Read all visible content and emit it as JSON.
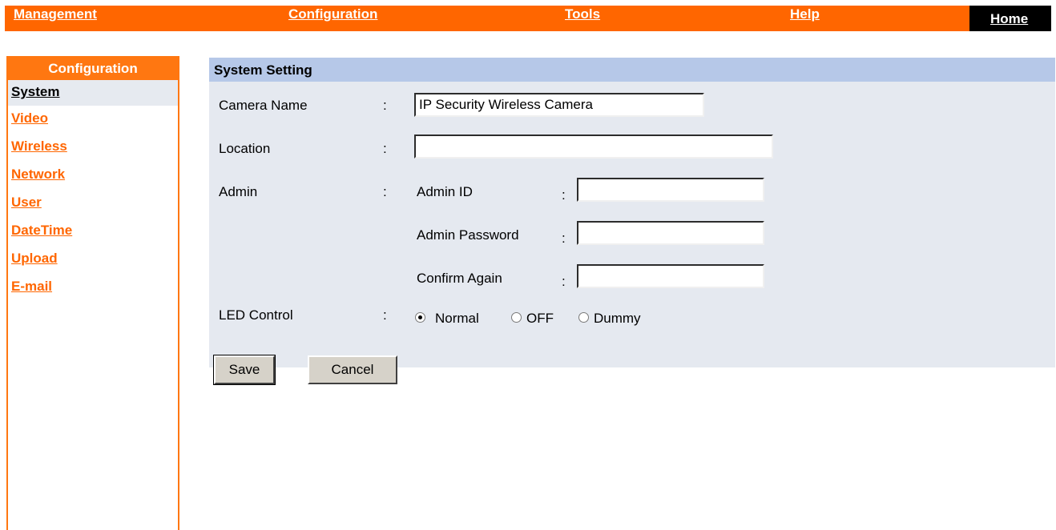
{
  "topnav": {
    "management": "Management",
    "configuration": "Configuration",
    "tools": "Tools",
    "help": "Help",
    "home": "Home"
  },
  "sidebar": {
    "title": "Configuration",
    "items": [
      {
        "label": "System",
        "active": true
      },
      {
        "label": "Video"
      },
      {
        "label": "Wireless"
      },
      {
        "label": "Network"
      },
      {
        "label": "User"
      },
      {
        "label": "DateTime"
      },
      {
        "label": "Upload"
      },
      {
        "label": "E-mail"
      }
    ]
  },
  "panel": {
    "title": "System Setting",
    "colon": ":",
    "camera_name": {
      "label": "Camera Name",
      "value": "IP Security Wireless Camera"
    },
    "location": {
      "label": "Location",
      "value": ""
    },
    "admin": {
      "label": "Admin",
      "id_label": "Admin ID",
      "password_label": "Admin Password",
      "confirm_label": "Confirm Again",
      "id_value": "",
      "password_value": "",
      "confirm_value": ""
    },
    "led": {
      "label": "LED Control",
      "options": [
        "Normal",
        "OFF",
        "Dummy"
      ],
      "selected": "Normal"
    },
    "save_label": "Save",
    "cancel_label": "Cancel"
  },
  "colors": {
    "accent": "#ff6600",
    "panel_bg": "#e5e9f0",
    "panel_header": "#b6c8e8"
  }
}
